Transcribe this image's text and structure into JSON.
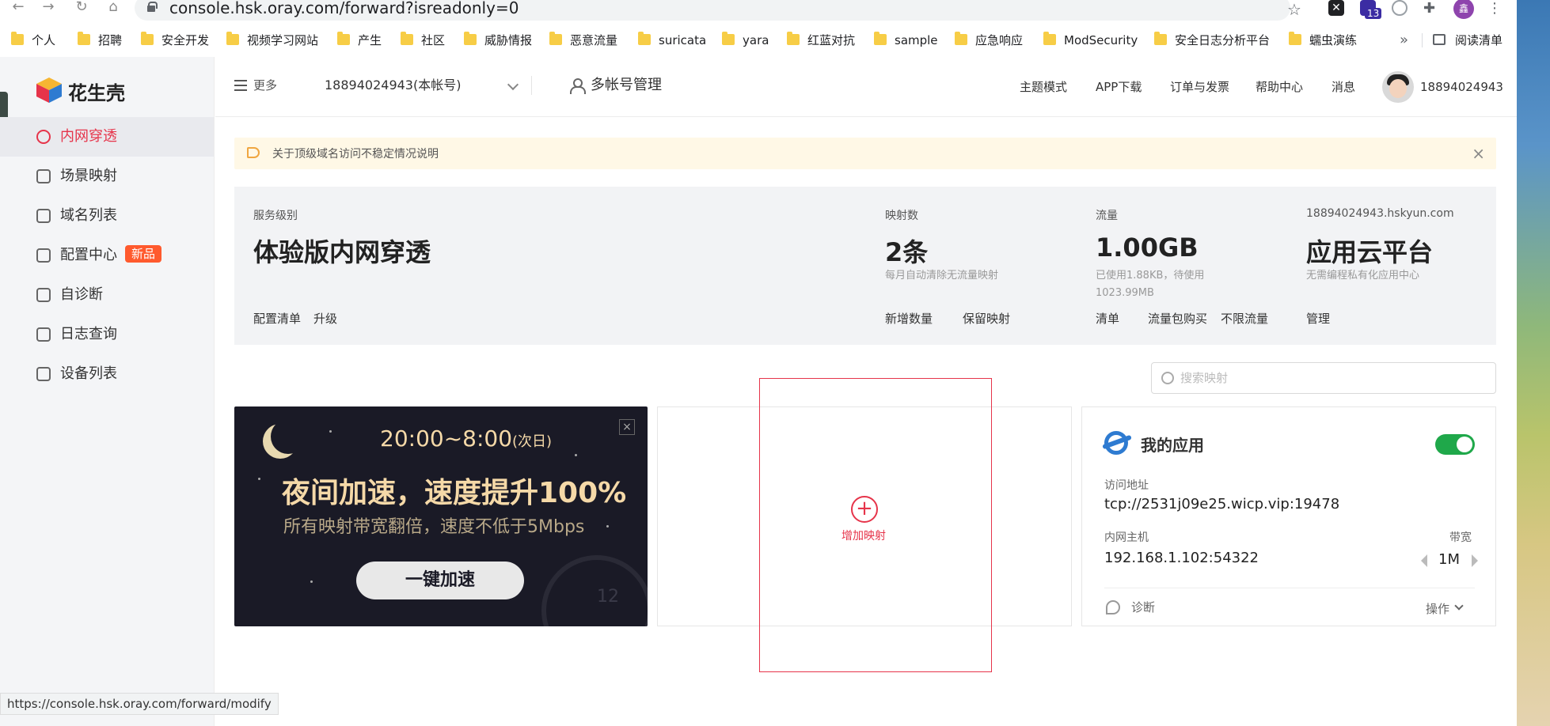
{
  "browser": {
    "url": "console.hsk.oray.com/forward?isreadonly=0",
    "ext_badge": "13",
    "profile_initial": "鑫",
    "bookmarks": [
      "个人",
      "招聘",
      "安全开发",
      "视频学习网站",
      "产生",
      "社区",
      "威胁情报",
      "恶意流量",
      "suricata",
      "yara",
      "红蓝对抗",
      "sample",
      "应急响应",
      "ModSecurity",
      "安全日志分析平台",
      "蠕虫演练"
    ],
    "bookmarks_more": "»",
    "reading_list": "阅读清单"
  },
  "sidebar": {
    "logo_text": "花生壳",
    "items": [
      {
        "label": "内网穿透",
        "icon": "cube-icon",
        "active": true
      },
      {
        "label": "场景映射",
        "icon": "scene-icon"
      },
      {
        "label": "域名列表",
        "icon": "domain-icon"
      },
      {
        "label": "配置中心",
        "icon": "grid-icon",
        "badge": "新品"
      },
      {
        "label": "自诊断",
        "icon": "diagnose-icon"
      },
      {
        "label": "日志查询",
        "icon": "log-icon"
      },
      {
        "label": "设备列表",
        "icon": "device-icon"
      }
    ]
  },
  "topbar": {
    "more": "更多",
    "account": "18894024943(本帐号)",
    "multi_account": "多帐号管理",
    "links": [
      "主题模式",
      "APP下载",
      "订单与发票",
      "帮助中心",
      "消息"
    ],
    "username": "18894024943"
  },
  "notice": {
    "text": "关于顶级域名访问不稳定情况说明",
    "close": "×"
  },
  "stats": {
    "service_level": {
      "label": "服务级别",
      "value": "体验版内网穿透",
      "links": [
        "配置清单",
        "升级"
      ]
    },
    "mappings": {
      "label": "映射数",
      "value": "2条",
      "sub": "每月自动清除无流量映射",
      "links": [
        "新增数量",
        "保留映射"
      ]
    },
    "traffic": {
      "label": "流量",
      "value": "1.00GB",
      "sub1": "已使用1.88KB，待使用",
      "sub2": "1023.99MB",
      "links": [
        "清单",
        "流量包购买",
        "不限流量"
      ]
    },
    "cloud": {
      "label": "18894024943.hskyun.com",
      "value": "应用云平台",
      "sub": "无需编程私有化应用中心",
      "links": [
        "管理"
      ]
    }
  },
  "search": {
    "placeholder": "搜索映射"
  },
  "promo": {
    "time": "20:00~8:00",
    "time_suffix": "(次日)",
    "headline": "夜间加速，速度提升100%",
    "subline": "所有映射带宽翻倍，速度不低于5Mbps",
    "button": "一键加速",
    "close": "×",
    "clock_num": "12"
  },
  "add_card": {
    "icon": "+",
    "label": "增加映射"
  },
  "app_card": {
    "title": "我的应用",
    "toggle_on": true,
    "access_label": "访问地址",
    "access_value": "tcp://2531j09e25.wicp.vip:19478",
    "host_label": "内网主机",
    "host_value": "192.168.1.102:54322",
    "bw_label": "带宽",
    "bw_value": "1M",
    "diagnose": "诊断",
    "ops": "操作"
  },
  "status_bar": {
    "url": "https://console.hsk.oray.com/forward/modify"
  },
  "colors": {
    "accent": "#e6344a",
    "toggle": "#1fa84a",
    "promo_bg": "#1a1a26",
    "promo_text": "#f5d9a8"
  }
}
